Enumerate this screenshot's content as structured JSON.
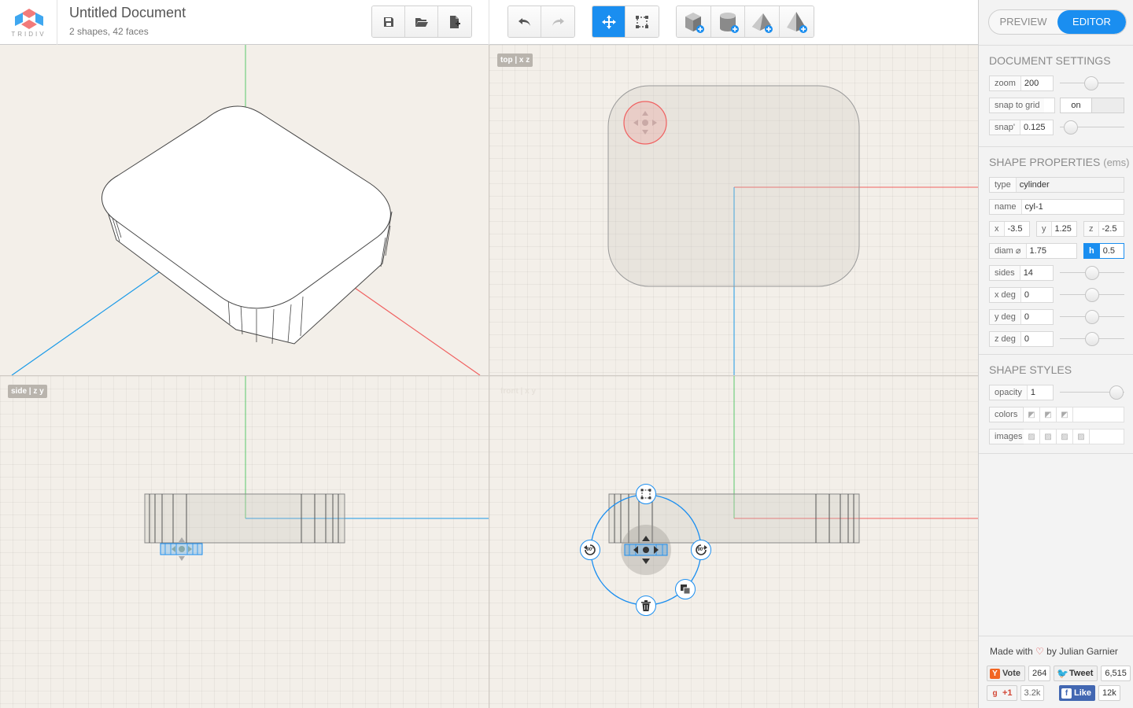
{
  "app": {
    "logo_text": "TRIDIV",
    "title": "Untitled Document",
    "subtitle": "2 shapes, 42 faces"
  },
  "toolbar": {
    "file": [
      {
        "name": "save-button",
        "icon": "save-icon"
      },
      {
        "name": "open-button",
        "icon": "folder-open-icon"
      },
      {
        "name": "new-document-button",
        "icon": "new-file-icon"
      }
    ],
    "history": [
      {
        "name": "undo-button",
        "icon": "undo-icon"
      },
      {
        "name": "redo-button",
        "icon": "redo-icon",
        "disabled": true
      }
    ],
    "tools": [
      {
        "name": "move-tool-button",
        "icon": "move-icon",
        "active": true
      },
      {
        "name": "select-tool-button",
        "icon": "selection-icon"
      }
    ],
    "shapes": [
      {
        "name": "add-cuboid-button",
        "icon": "cuboid-icon"
      },
      {
        "name": "add-cylinder-button",
        "icon": "cylinder-icon"
      },
      {
        "name": "add-prism-button",
        "icon": "prism-icon"
      },
      {
        "name": "add-pyramid-button",
        "icon": "pyramid-icon"
      }
    ]
  },
  "viewports": {
    "top_label": "top | x z",
    "side_label": "side | z y",
    "front_label": "front | x y"
  },
  "gizmo": {
    "rotate_left_label": "90°",
    "rotate_right_label": "90°"
  },
  "colors": {
    "accent": "#1a8ef0",
    "axis_x": "#f06060",
    "axis_y": "#5ac86a",
    "axis_z": "#1a9ae8"
  },
  "panel": {
    "modes": {
      "preview": "PREVIEW",
      "editor": "EDITOR",
      "active": "editor"
    },
    "document": {
      "title": "DOCUMENT SETTINGS",
      "zoom_label": "zoom",
      "zoom_value": "200",
      "snap_grid_label": "snap to grid",
      "snap_grid_state": "on",
      "snap_label": "snap'",
      "snap_value": "0.125"
    },
    "shape": {
      "title": "SHAPE PROPERTIES",
      "title_unit": "(ems)",
      "type_label": "type",
      "type_value": "cylinder",
      "name_label": "name",
      "name_value": "cyl-1",
      "x_label": "x",
      "x_value": "-3.5",
      "y_label": "y",
      "y_value": "1.25",
      "z_label": "z",
      "z_value": "-2.5",
      "diam_label": "diam ⌀",
      "diam_value": "1.75",
      "h_label": "h",
      "h_value": "0.5",
      "sides_label": "sides",
      "sides_value": "14",
      "xdeg_label": "x deg",
      "xdeg_value": "0",
      "ydeg_label": "y deg",
      "ydeg_value": "0",
      "zdeg_label": "z deg",
      "zdeg_value": "0"
    },
    "styles": {
      "title": "SHAPE STYLES",
      "opacity_label": "opacity",
      "opacity_value": "1",
      "colors_label": "colors",
      "images_label": "images"
    },
    "credit": {
      "prefix": "Made with",
      "heart": "♡",
      "suffix": "by Julian Garnier"
    },
    "social": {
      "vote": {
        "label": "Vote",
        "count": "264"
      },
      "tweet": {
        "label": "Tweet",
        "count": "6,515"
      },
      "gplus": {
        "label": "+1",
        "count": "3.2k"
      },
      "like": {
        "label": "Like",
        "count": "12k"
      }
    }
  }
}
